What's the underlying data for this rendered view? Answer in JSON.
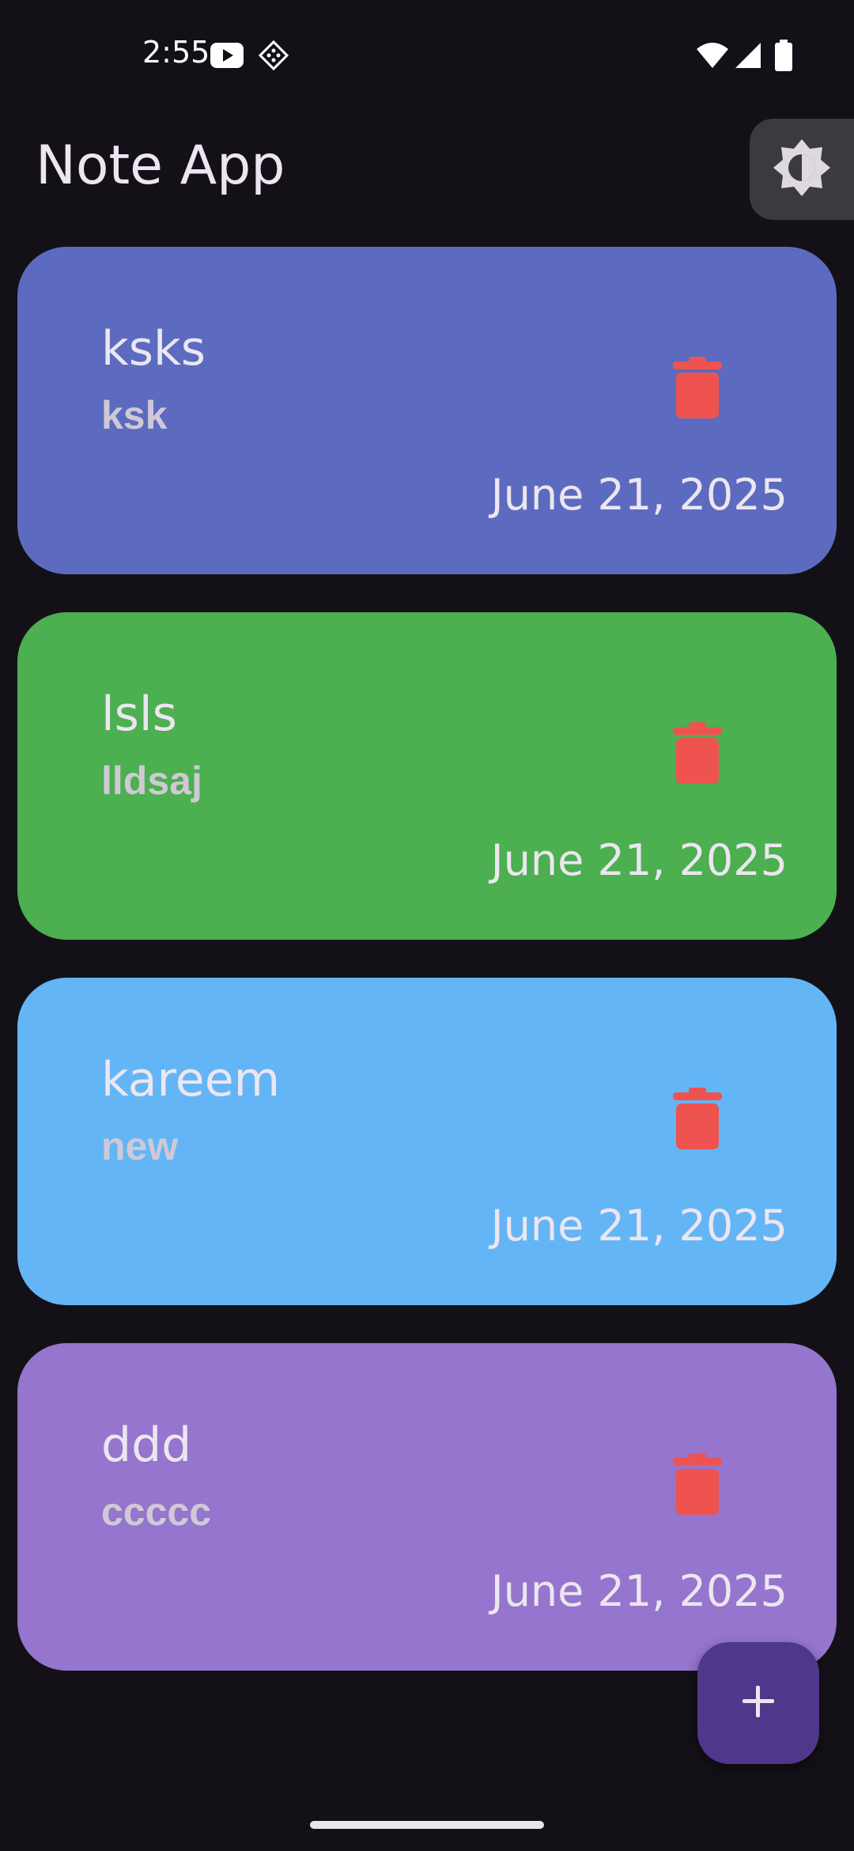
{
  "status_bar": {
    "time": "2:55",
    "left_icons": [
      "youtube-icon",
      "remote-access-icon"
    ],
    "right_icons": [
      "wifi-icon",
      "cellular-signal-icon",
      "battery-icon"
    ]
  },
  "app_bar": {
    "title": "Note App",
    "theme_toggle_icon": "brightness-icon"
  },
  "notes": [
    {
      "title": "ksks",
      "content": "ksk",
      "date": "June 21, 2025",
      "color": "#5c6bc0"
    },
    {
      "title": "lsls",
      "content": "lldsaj",
      "date": "June 21, 2025",
      "color": "#4caf50"
    },
    {
      "title": "kareem",
      "content": "new",
      "date": "June 21, 2025",
      "color": "#64b5f6"
    },
    {
      "title": "ddd",
      "content": "ccccc",
      "date": "June 21, 2025",
      "color": "#9575cd"
    }
  ],
  "delete_icon": "trash-icon",
  "delete_icon_color": "#ef5350",
  "fab": {
    "icon": "plus-icon",
    "color": "#4f378b"
  }
}
